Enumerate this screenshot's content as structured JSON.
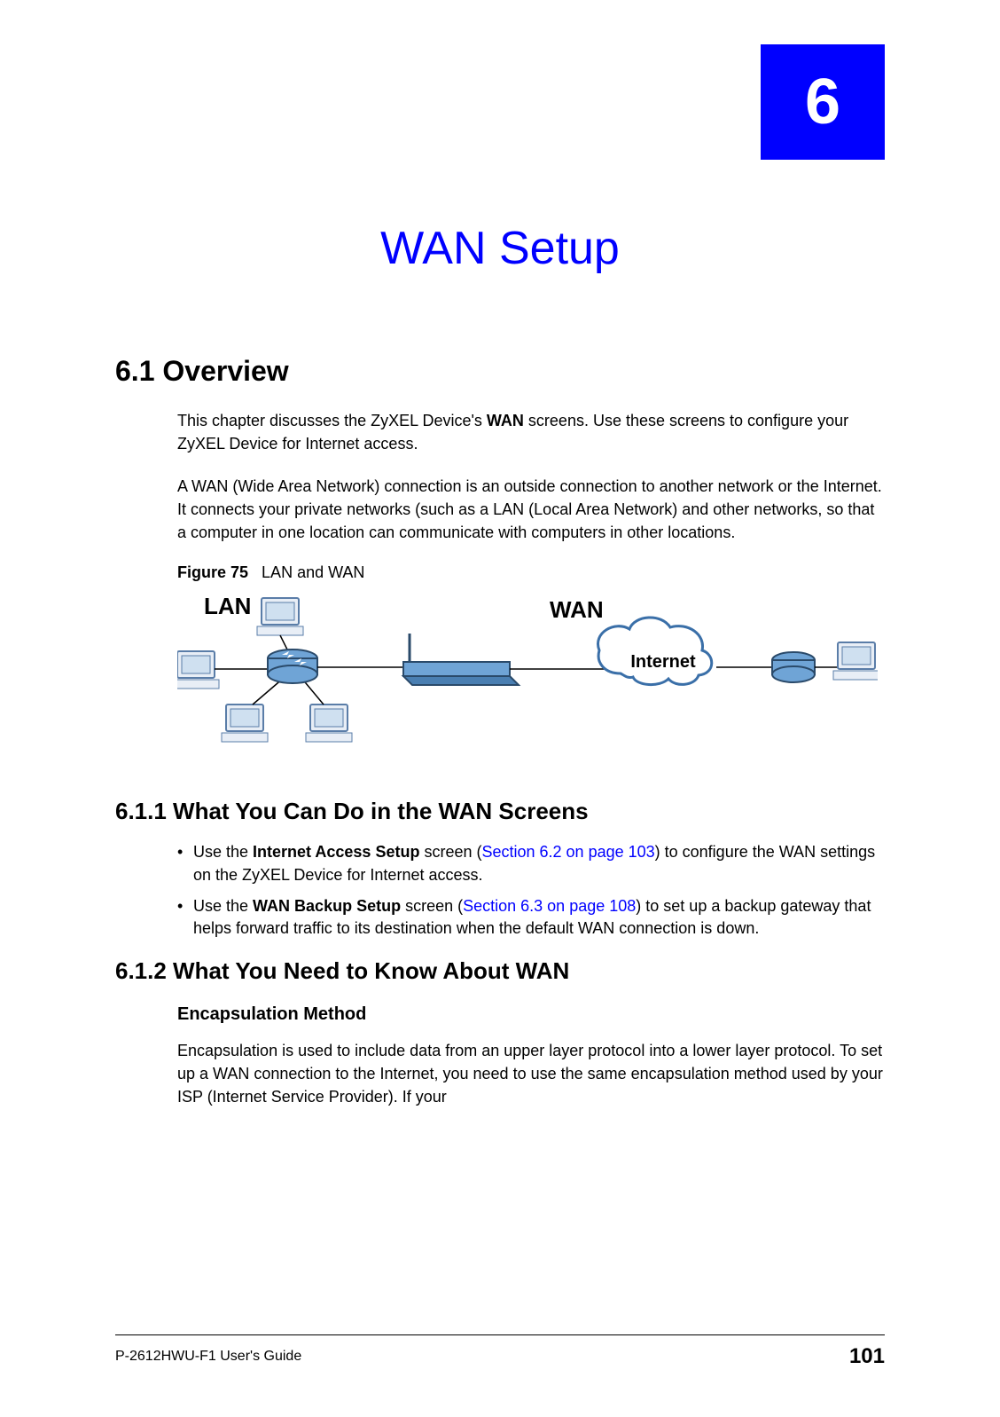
{
  "chapter": {
    "number": "6",
    "title": "WAN Setup"
  },
  "section_6_1": {
    "heading": "6.1  Overview",
    "para1_a": "This chapter discusses the ZyXEL Device's ",
    "para1_b_bold": "WAN",
    "para1_c": " screens. Use these screens to configure your ZyXEL Device for Internet access.",
    "para2": "A WAN (Wide Area Network) connection is an outside connection to another network or the Internet. It connects your private networks (such as a LAN (Local Area Network) and other networks, so that a computer in one location can communicate with computers in other locations."
  },
  "figure": {
    "label": "Figure 75",
    "caption": "LAN and WAN",
    "lan_label": "LAN",
    "wan_label": "WAN",
    "cloud_label": "Internet"
  },
  "section_6_1_1": {
    "heading": "6.1.1  What You Can Do in the WAN Screens",
    "bullet1_a": "Use the ",
    "bullet1_b_bold": "Internet Access Setup",
    "bullet1_c": " screen (",
    "bullet1_link": "Section 6.2 on page 103",
    "bullet1_d": ") to configure the WAN settings on the ZyXEL Device for Internet access.",
    "bullet2_a": "Use the ",
    "bullet2_b_bold": "WAN Backup Setup",
    "bullet2_c": " screen (",
    "bullet2_link": "Section 6.3 on page 108",
    "bullet2_d": ") to set up a backup gateway that helps forward traffic to its destination when the default WAN connection is down."
  },
  "section_6_1_2": {
    "heading": "6.1.2  What You Need to Know About WAN",
    "subhead": "Encapsulation Method",
    "para": "Encapsulation is used to include data from an upper layer protocol into a lower layer protocol. To set up a WAN connection to the Internet, you need to use the same encapsulation method used by your ISP (Internet Service Provider). If your"
  },
  "footer": {
    "guide": "P-2612HWU-F1 User's Guide",
    "page": "101"
  }
}
